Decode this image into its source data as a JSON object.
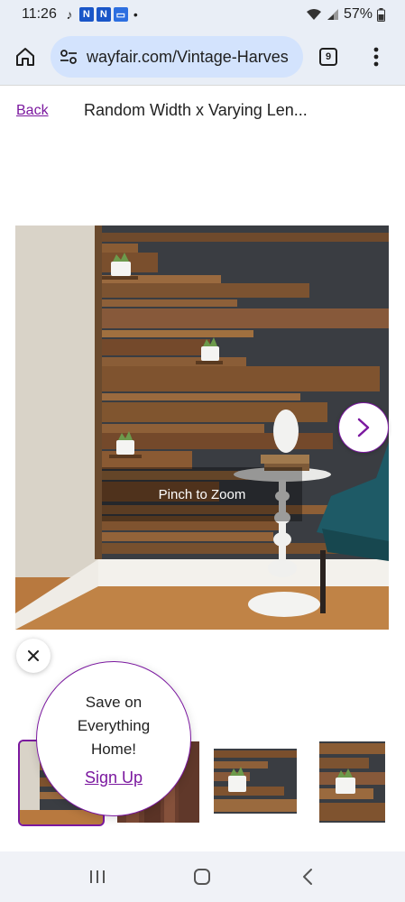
{
  "status_bar": {
    "time": "11:26",
    "battery": "57%",
    "app_icons": [
      "tiktok-icon",
      "nn-app-icon",
      "nn-app-icon",
      "screen-icon"
    ]
  },
  "browser": {
    "url": "wayfair.com/Vintage-Harves",
    "tab_count": "9"
  },
  "page": {
    "back_label": "Back",
    "title": "Random Width x Varying Len..."
  },
  "gallery": {
    "zoom_hint": "Pinch to Zoom",
    "thumbnails": [
      "thumbnail-1",
      "thumbnail-2",
      "thumbnail-3",
      "thumbnail-4"
    ]
  },
  "promo": {
    "text": "Save on Everything Home!",
    "link_label": "Sign Up"
  },
  "colors": {
    "accent": "#7b189f",
    "browser_bar": "#e9eef6",
    "url_pill": "#d3e3fd"
  }
}
